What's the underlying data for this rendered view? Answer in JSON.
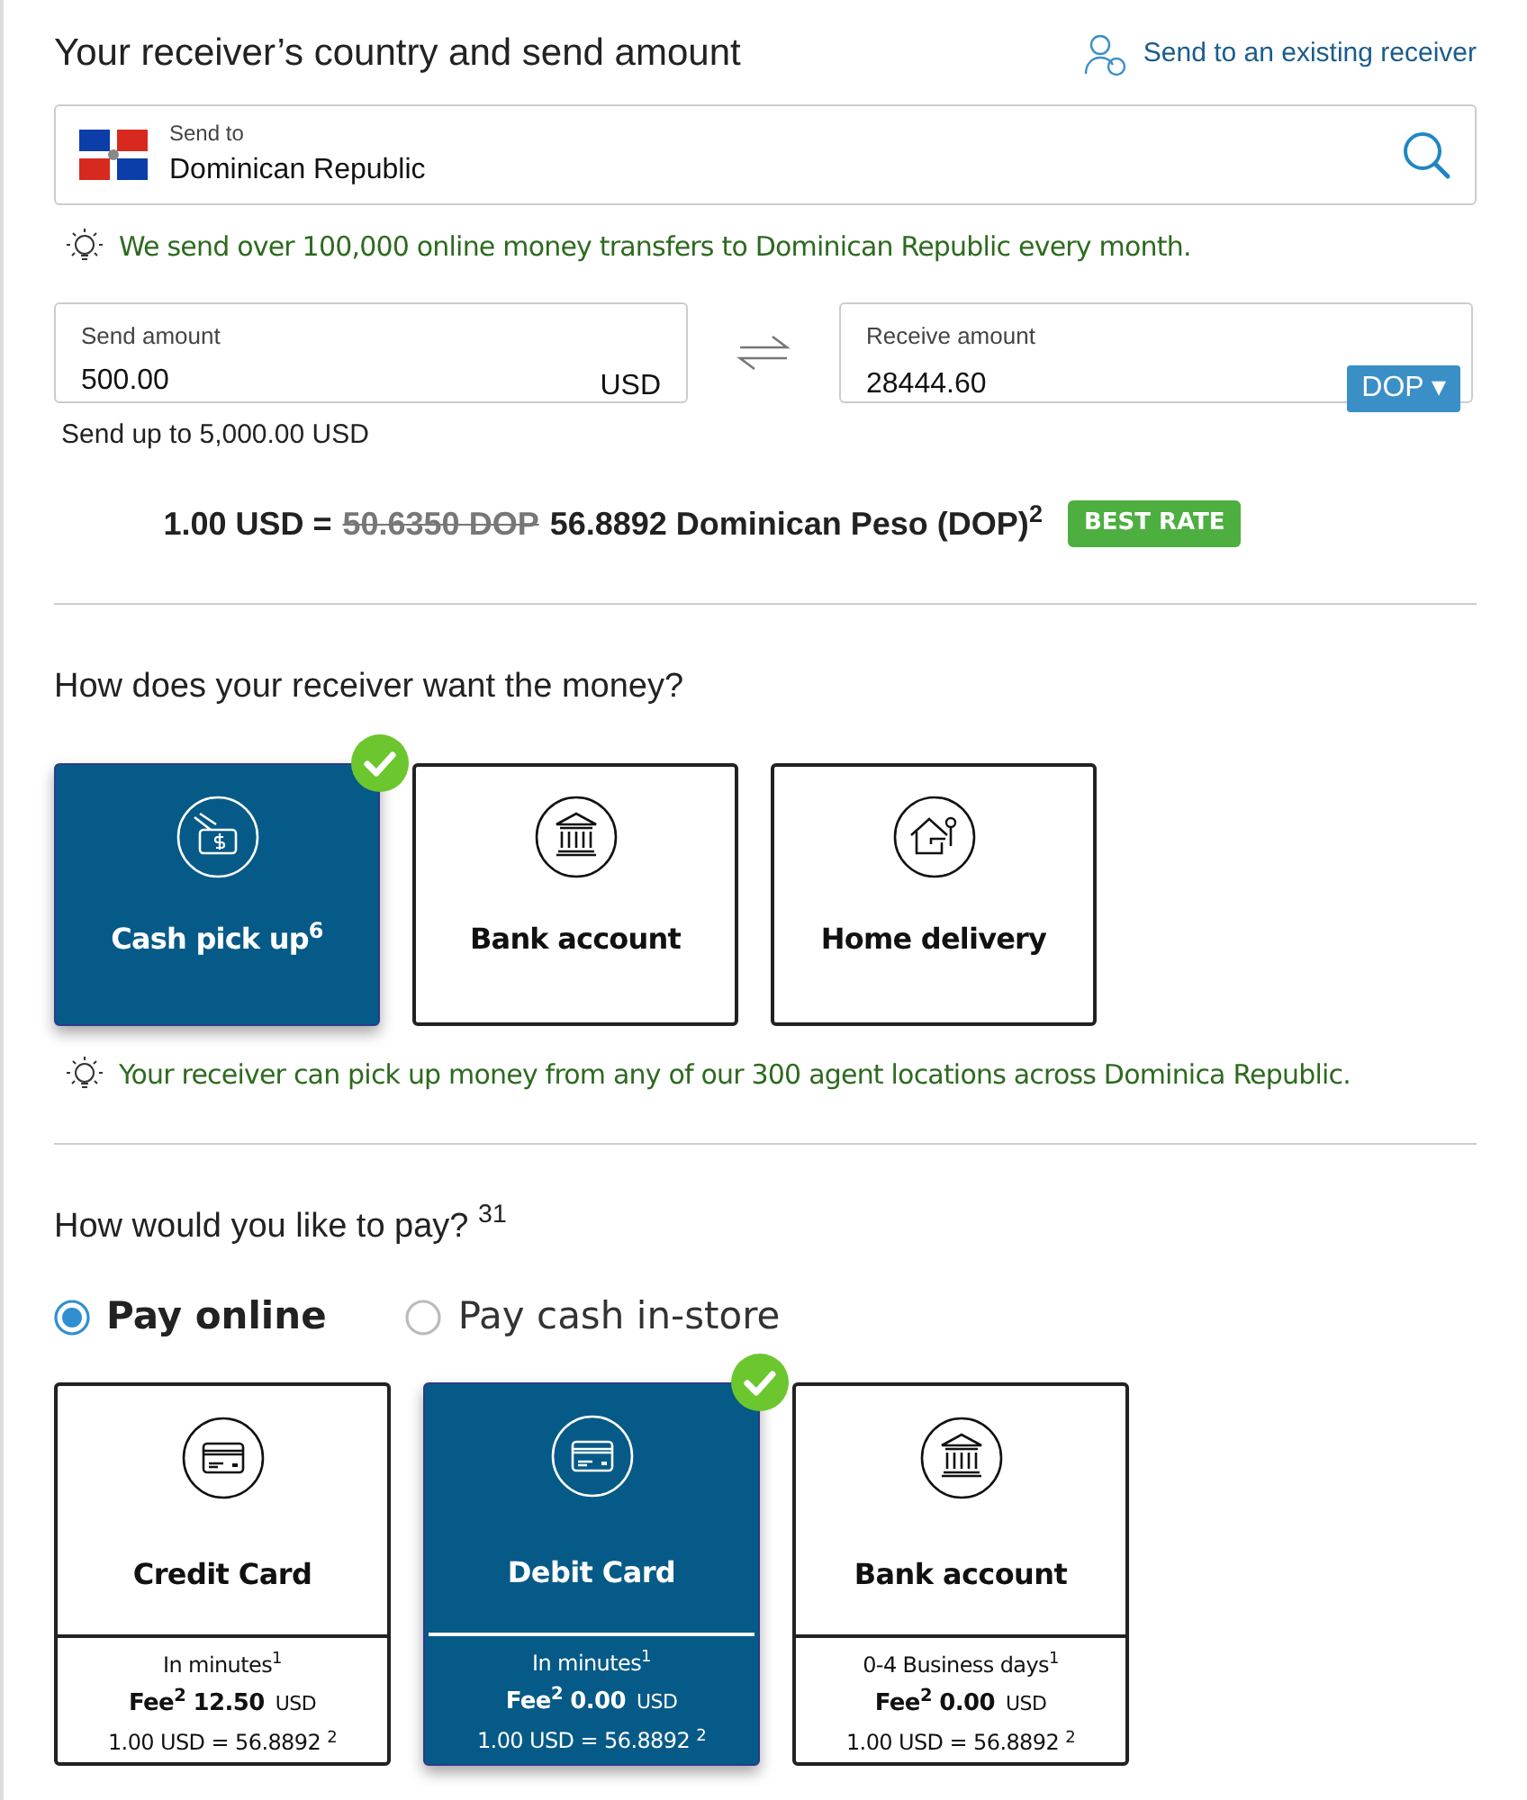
{
  "title": "Your receiver’s country and send amount",
  "existing_receiver_link": "Send to an existing receiver",
  "destination": {
    "label": "Send to",
    "value": "Dominican Republic"
  },
  "destination_hint": "We send over 100,000 online money transfers to Dominican Republic every month.",
  "send_amount": {
    "label": "Send amount",
    "value": "500.00",
    "currency": "USD"
  },
  "receive_amount": {
    "label": "Receive amount",
    "value": "28444.60",
    "currency": "DOP ▾"
  },
  "send_limit": "Send up to 5,000.00 USD",
  "rate": {
    "base": "1.00 USD =",
    "old": "50.6350 DOP",
    "new": "56.8892 Dominican Peso (DOP)$^{2}$",
    "badge": "BEST RATE"
  },
  "delivery": {
    "question": "How does your receiver want the money?",
    "options": [
      {
        "label": "Cash pick up$^{6}$",
        "kind": "cash",
        "selected": true
      },
      {
        "label": "Bank account",
        "kind": "bank",
        "selected": false
      },
      {
        "label": "Home delivery",
        "kind": "home",
        "selected": false
      }
    ],
    "hint": "Your receiver can pick up money from any of our 300 agent locations across Dominica Republic."
  },
  "payment": {
    "question": "How would you like to pay? $^{31}$",
    "methods": [
      {
        "label": "Pay online",
        "selected": true
      },
      {
        "label": "Pay cash in-store",
        "selected": false
      }
    ],
    "options": [
      {
        "label": "Credit Card",
        "kind": "card",
        "speed": "In minutes$^{1}$",
        "fee_label": "Fee$^{2}$",
        "fee": "12.50",
        "fee_currency": "USD",
        "rate": "1.00 USD = 56.8892 $^{2}$",
        "selected": false
      },
      {
        "label": "Debit Card",
        "kind": "card",
        "speed": "In minutes$^{1}$",
        "fee_label": "Fee$^{2}$",
        "fee": "0.00",
        "fee_currency": "USD",
        "rate": "1.00 USD = 56.8892 $^{2}$",
        "selected": true
      },
      {
        "label": "Bank account",
        "kind": "bank",
        "speed": "0-4 Business days$^{1}$",
        "fee_label": "Fee$^{2}$",
        "fee": "0.00",
        "fee_currency": "USD",
        "rate": "1.00 USD = 56.8892 $^{2}$",
        "selected": false
      }
    ]
  }
}
